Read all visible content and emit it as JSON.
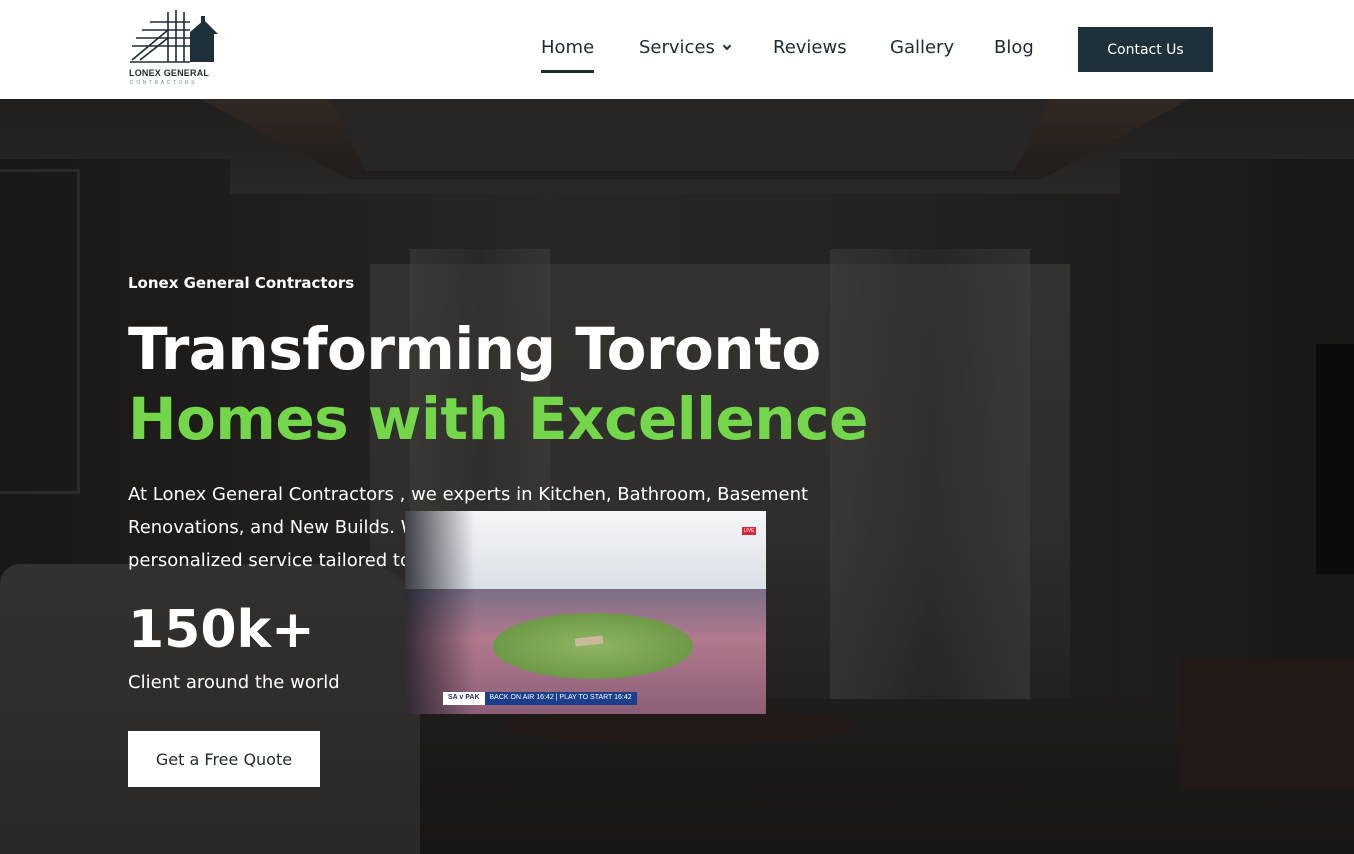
{
  "brand": {
    "name": "LONEX GENERAL",
    "subtitle": "CONTRACTORS"
  },
  "nav": {
    "home": "Home",
    "services": "Services",
    "reviews": "Reviews",
    "gallery": "Gallery",
    "blog": "Blog",
    "contact": "Contact Us"
  },
  "hero": {
    "eyebrow": "Lonex General Contractors",
    "title_line1": "Transforming Toronto",
    "title_line2": "Homes with Excellence",
    "description": "At Lonex General Contractors , we experts in Kitchen, Bathroom, Basement Renovations, and New Builds. We deliver quality craftsmanship and personalized service tailored to your needs.",
    "stat_number": "150k+",
    "stat_label": "Client around the world",
    "cta": "Get a Free Quote"
  },
  "video_overlay": {
    "score_label": "SA v PAK",
    "ticker_text": "BACK ON AIR 16:42 | PLAY TO START 16:42",
    "channel": "LIVE"
  },
  "colors": {
    "accent_green": "#74d64a",
    "dark_navy": "#1e3039",
    "text_dark": "#1e2b33"
  }
}
